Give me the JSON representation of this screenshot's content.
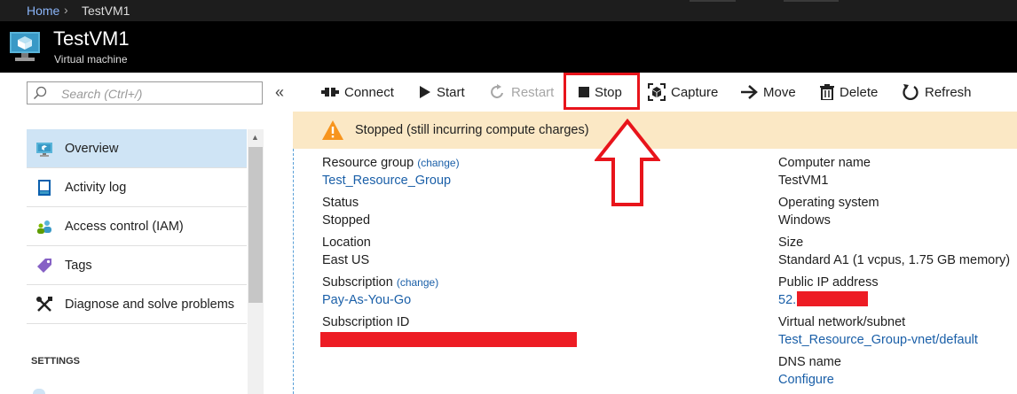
{
  "breadcrumb": {
    "home": "Home",
    "separator": "›",
    "current": "TestVM1"
  },
  "resource": {
    "title": "TestVM1",
    "subtitle": "Virtual machine"
  },
  "search": {
    "placeholder": "Search (Ctrl+/)"
  },
  "collapse_glyph": "«",
  "nav": {
    "items": [
      {
        "label": "Overview",
        "icon": "overview-monitor-icon"
      },
      {
        "label": "Activity log",
        "icon": "activity-log-icon"
      },
      {
        "label": "Access control (IAM)",
        "icon": "iam-people-icon"
      },
      {
        "label": "Tags",
        "icon": "tag-icon"
      },
      {
        "label": "Diagnose and solve problems",
        "icon": "wrench-icon"
      }
    ],
    "settings_header": "SETTINGS"
  },
  "commands": [
    {
      "label": "Connect",
      "icon": "connect-icon",
      "enabled": true
    },
    {
      "label": "Start",
      "icon": "play-icon",
      "enabled": true
    },
    {
      "label": "Restart",
      "icon": "restart-icon",
      "enabled": false
    },
    {
      "label": "Stop",
      "icon": "stop-icon",
      "enabled": true
    },
    {
      "label": "Capture",
      "icon": "capture-icon",
      "enabled": true
    },
    {
      "label": "Move",
      "icon": "arrow-right-icon",
      "enabled": true
    },
    {
      "label": "Delete",
      "icon": "trash-icon",
      "enabled": true
    },
    {
      "label": "Refresh",
      "icon": "refresh-icon",
      "enabled": true
    }
  ],
  "warning": {
    "text": "Stopped (still incurring compute charges)",
    "icon": "warning-triangle-icon"
  },
  "essentials": {
    "left": {
      "resource_group_label": "Resource group",
      "resource_group_change": "(change)",
      "resource_group_value": "Test_Resource_Group",
      "status_label": "Status",
      "status_value": "Stopped",
      "location_label": "Location",
      "location_value": "East US",
      "subscription_label": "Subscription",
      "subscription_change": "(change)",
      "subscription_value": "Pay-As-You-Go",
      "subscription_id_label": "Subscription ID"
    },
    "right": {
      "computer_name_label": "Computer name",
      "computer_name_value": "TestVM1",
      "os_label": "Operating system",
      "os_value": "Windows",
      "size_label": "Size",
      "size_value": "Standard A1 (1 vcpus, 1.75 GB memory)",
      "public_ip_label": "Public IP address",
      "public_ip_value": "52.",
      "vnet_label": "Virtual network/subnet",
      "vnet_value": "Test_Resource_Group-vnet/default",
      "dns_label": "DNS name",
      "dns_value": "Configure"
    }
  },
  "colors": {
    "link": "#1a5fa8",
    "annotation_red": "#e8141b",
    "warning_bg": "#fbe8c5",
    "active_nav_bg": "#cfe4f5"
  }
}
